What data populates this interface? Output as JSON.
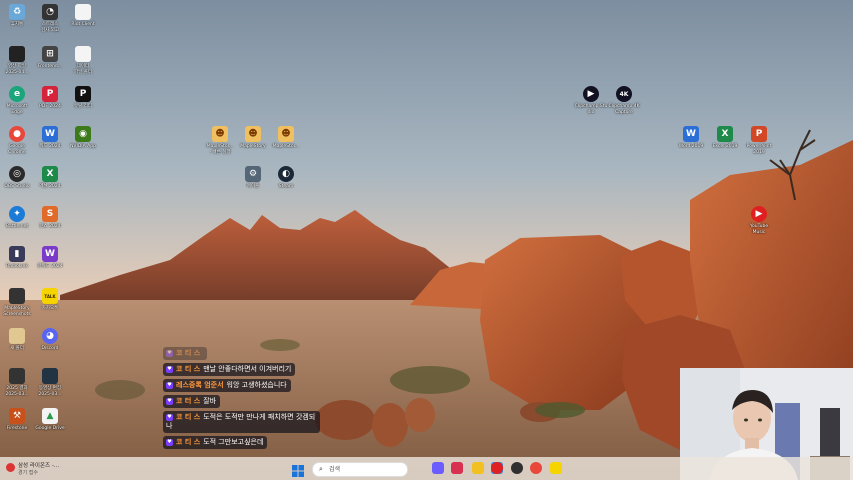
{
  "desktop": {
    "icons": [
      {
        "label": "휴지통",
        "icon": "recycle-bin-icon",
        "color": "#6aa8d8",
        "glyph": "♻"
      },
      {
        "label": "스트레스\n검사 외고",
        "icon": "gauge-icon",
        "color": "#333333",
        "glyph": "◔"
      },
      {
        "label": "Riot Client",
        "icon": "document-icon",
        "color": "#f4f4f4",
        "glyph": ""
      },
      {
        "label": "영상 파일\n2025-04...",
        "icon": "video-file-icon",
        "color": "#222222",
        "glyph": ""
      },
      {
        "label": "Frontend...",
        "icon": "app-window-icon",
        "color": "#444444",
        "glyph": "⊞"
      },
      {
        "label": "데이터\n파일 폴더",
        "icon": "document-icon",
        "color": "#f4f4f4",
        "glyph": ""
      },
      {
        "label": "Microsoft\nEdge",
        "icon": "edge-icon",
        "color": "#1aa57a",
        "glyph": "e"
      },
      {
        "label": "PDF 2024",
        "icon": "pdf-icon",
        "color": "#d4233a",
        "glyph": "P"
      },
      {
        "label": "유틸 리티",
        "icon": "utility-icon",
        "color": "#111111",
        "glyph": "P"
      },
      {
        "label": "Google\nChrome",
        "icon": "chrome-icon",
        "color": "#e8473a",
        "glyph": "●"
      },
      {
        "label": "워드 2024",
        "icon": "word-icon",
        "color": "#2b6fd6",
        "glyph": "W"
      },
      {
        "label": "NVIDIA App",
        "icon": "nvidia-icon",
        "color": "#3c7a1a",
        "glyph": "◉"
      },
      {
        "label": "OBS Studio",
        "icon": "obs-icon",
        "color": "#2a2a2a",
        "glyph": "◎"
      },
      {
        "label": "엑셀 2024",
        "icon": "excel-icon",
        "color": "#1e8a4a",
        "glyph": "X"
      },
      {
        "label": "Battle.net",
        "icon": "battlenet-icon",
        "color": "#1c7bd6",
        "glyph": "✦"
      },
      {
        "label": "한쇼 2024",
        "icon": "hanshow-icon",
        "color": "#e06a2a",
        "glyph": "S"
      },
      {
        "label": "RadioLink",
        "icon": "radio-icon",
        "color": "#3a3a5a",
        "glyph": "▮"
      },
      {
        "label": "한워드 2024",
        "icon": "hanword-icon",
        "color": "#7a3cc8",
        "glyph": "W"
      },
      {
        "label": "MapleStory\nScreenshots",
        "icon": "folder-icon",
        "color": "#333333",
        "glyph": ""
      },
      {
        "label": "카카오톡",
        "icon": "kakaotalk-icon",
        "color": "#f5d400",
        "glyph": "TALK"
      },
      {
        "label": "새 폴더",
        "icon": "folder-icon",
        "color": "#e0c890",
        "glyph": ""
      },
      {
        "label": "Discord",
        "icon": "discord-icon",
        "color": "#5865f2",
        "glyph": "◕"
      },
      {
        "label": "2025 결과\n2025-03...",
        "icon": "video-file-icon",
        "color": "#333333",
        "glyph": ""
      },
      {
        "label": "동영상 편집\n2025-03...",
        "icon": "video-file-icon",
        "color": "#223344",
        "glyph": ""
      },
      {
        "label": "Firestone",
        "icon": "firestone-icon",
        "color": "#c8501a",
        "glyph": "⚒"
      },
      {
        "label": "Google Drive",
        "icon": "google-drive-icon",
        "color": "#f4f4f4",
        "glyph": "▲"
      },
      {
        "label": "MapleStor...\n- 빠른 실행",
        "icon": "maplestory-icon",
        "color": "#f0c060",
        "glyph": "☻"
      },
      {
        "label": "MapleStory",
        "icon": "maplestory-icon",
        "color": "#f0c060",
        "glyph": "☻"
      },
      {
        "label": "MapleStor...",
        "icon": "maplestory-icon",
        "color": "#f0c060",
        "glyph": "☻"
      },
      {
        "label": "메이플",
        "icon": "settings-app-icon",
        "color": "#556677",
        "glyph": "⚙"
      },
      {
        "label": "Steam",
        "icon": "steam-icon",
        "color": "#1b2838",
        "glyph": "◐"
      },
      {
        "label": "Clipchamp Studio",
        "icon": "play-circle-icon",
        "color": "#111122",
        "glyph": "▶"
      },
      {
        "label": "Clipchamp 4K\nCapture",
        "icon": "4k-icon",
        "color": "#111122",
        "glyph": "4K"
      },
      {
        "label": "Word 2019",
        "icon": "word-icon",
        "color": "#2b6fd6",
        "glyph": "W"
      },
      {
        "label": "Excel 2019",
        "icon": "excel-icon",
        "color": "#1e8a4a",
        "glyph": "X"
      },
      {
        "label": "PowerPoint\n2019",
        "icon": "powerpoint-icon",
        "color": "#d24726",
        "glyph": "P"
      },
      {
        "label": "YouTube\nMusic",
        "icon": "youtube-music-icon",
        "color": "#e02020",
        "glyph": "▶"
      }
    ]
  },
  "chat": {
    "messages": [
      {
        "nick": "코 티 스",
        "text": "",
        "faded": true
      },
      {
        "nick": "코 티 스",
        "text": "맨날 안좋다하면서 이겨버리기",
        "faded": false
      },
      {
        "nick": "레스중록 엄준서",
        "text": "워앙 고생하셨습니다",
        "faded": false
      },
      {
        "nick": "코 터 스",
        "text": "잘바",
        "faded": false
      },
      {
        "nick": "코 티 스",
        "text": "도적은 도적만 만나게 패치하면 갓겜되나",
        "faded": false
      },
      {
        "nick": "코 티 스",
        "text": "도적 그만보고싶은데",
        "faded": false
      }
    ],
    "nick_color": "#ff9a3c"
  },
  "taskbar": {
    "notification_title": "삼성 라이온즈 -...",
    "notification_sub": "경기 접수",
    "search_placeholder": "검색",
    "apps": [
      {
        "name": "copilot-icon",
        "color": "#6a5cff"
      },
      {
        "name": "app-red-icon",
        "color": "#d83050"
      },
      {
        "name": "file-explorer-icon",
        "color": "#f2c020"
      },
      {
        "name": "app-blue-icon",
        "color": "#3080e0"
      },
      {
        "name": "youtube-music-icon",
        "color": "#e02020"
      },
      {
        "name": "obs-icon",
        "color": "#303030"
      },
      {
        "name": "chrome-icon",
        "color": "#e8473a"
      },
      {
        "name": "kakaotalk-icon",
        "color": "#f5d400"
      }
    ]
  }
}
